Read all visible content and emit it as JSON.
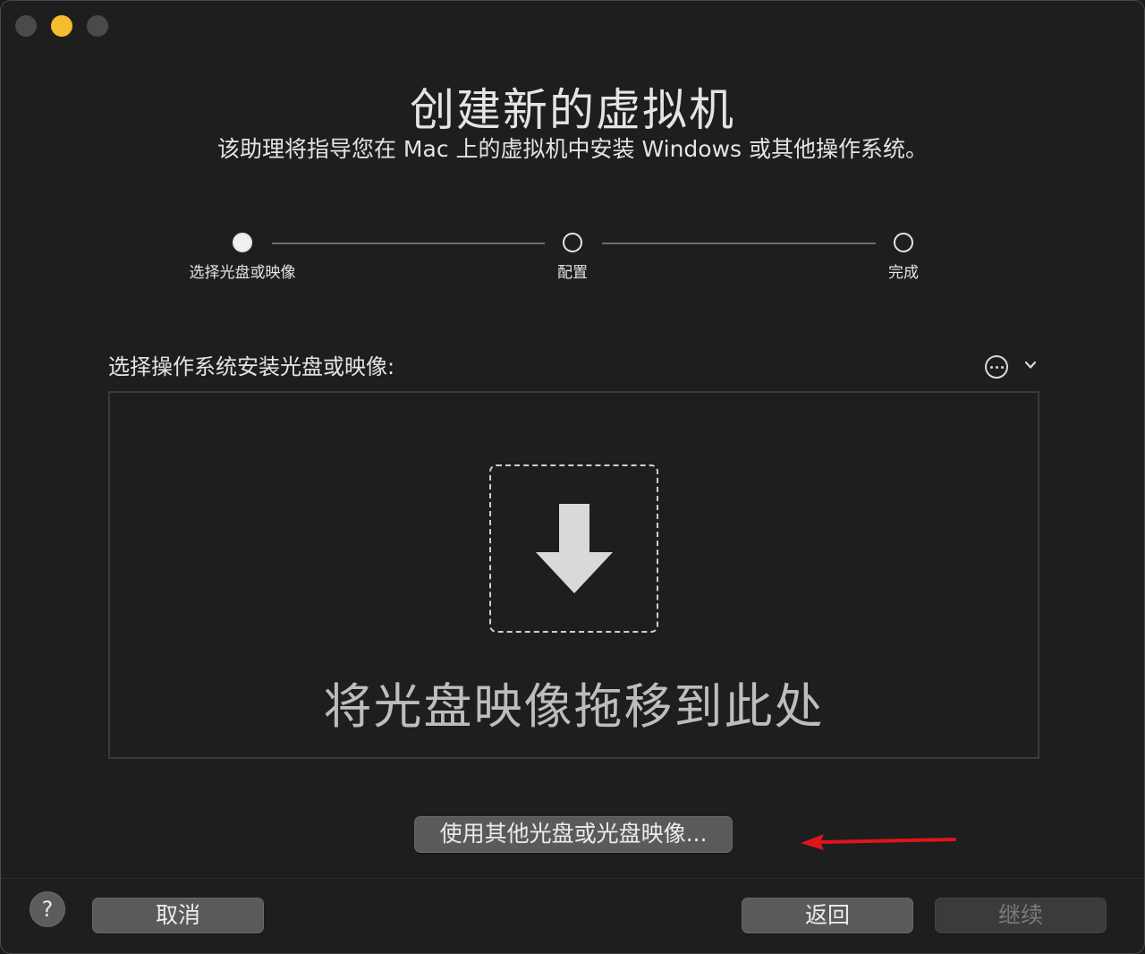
{
  "window": {
    "traffic_lights": [
      "close",
      "minimize",
      "maximize"
    ],
    "accent_color": "#f4bd2f"
  },
  "header": {
    "title": "创建新的虚拟机",
    "subtitle": "该助理将指导您在 Mac 上的虚拟机中安装 Windows 或其他操作系统。"
  },
  "stepper": {
    "steps": [
      {
        "label": "选择光盘或映像",
        "state": "active"
      },
      {
        "label": "配置",
        "state": "pending"
      },
      {
        "label": "完成",
        "state": "pending"
      }
    ]
  },
  "source": {
    "label": "选择操作系统安装光盘或映像:",
    "drop_text": "将光盘映像拖移到此处",
    "other_button": "使用其他光盘或光盘映像..."
  },
  "footer": {
    "help": "?",
    "cancel": "取消",
    "back": "返回",
    "continue": "继续",
    "continue_enabled": false
  },
  "annotation": {
    "color": "#e0141b"
  }
}
